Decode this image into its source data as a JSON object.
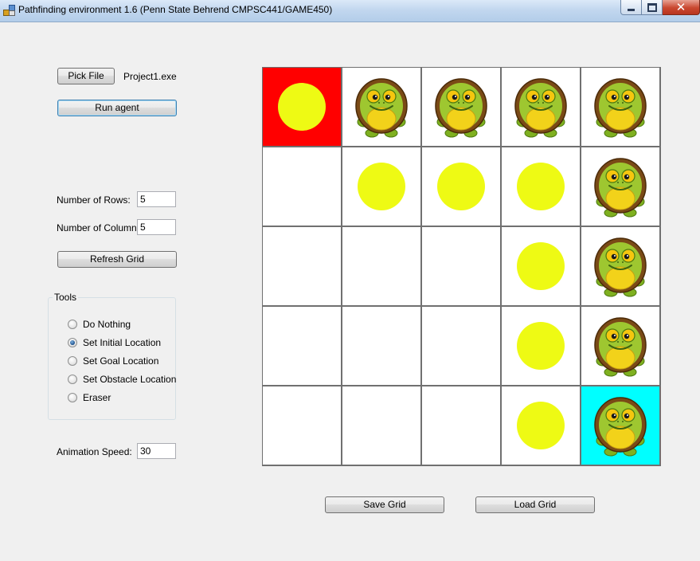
{
  "window": {
    "title": "Pathfinding environment 1.6 (Penn State Behrend CMPSC441/GAME450)"
  },
  "controls": {
    "pick_file_label": "Pick File",
    "file_name": "Project1.exe",
    "run_agent_label": "Run agent",
    "rows_label": "Number of Rows:",
    "rows_value": "5",
    "columns_label": "Number of Columns:",
    "columns_value": "5",
    "refresh_label": "Refresh Grid",
    "speed_label": "Animation Speed:",
    "speed_value": "30",
    "save_label": "Save Grid",
    "load_label": "Load Grid"
  },
  "tools": {
    "title": "Tools",
    "options": [
      {
        "label": "Do Nothing",
        "checked": false
      },
      {
        "label": "Set Initial Location",
        "checked": true
      },
      {
        "label": "Set Goal Location",
        "checked": false
      },
      {
        "label": "Set Obstacle Location",
        "checked": false
      },
      {
        "label": "Eraser",
        "checked": false
      }
    ]
  },
  "grid": {
    "rows": 5,
    "columns": 5,
    "colors": {
      "start": "#ff0000",
      "goal": "#00ffff",
      "path": "#eefa14",
      "empty": "#ffffff"
    },
    "cells": [
      [
        "start-path",
        "turtle",
        "turtle",
        "turtle",
        "turtle"
      ],
      [
        "empty",
        "path",
        "path",
        "path",
        "turtle"
      ],
      [
        "empty",
        "empty",
        "empty",
        "path",
        "turtle"
      ],
      [
        "empty",
        "empty",
        "empty",
        "path",
        "turtle"
      ],
      [
        "empty",
        "empty",
        "empty",
        "path",
        "goal-turtle"
      ]
    ]
  }
}
